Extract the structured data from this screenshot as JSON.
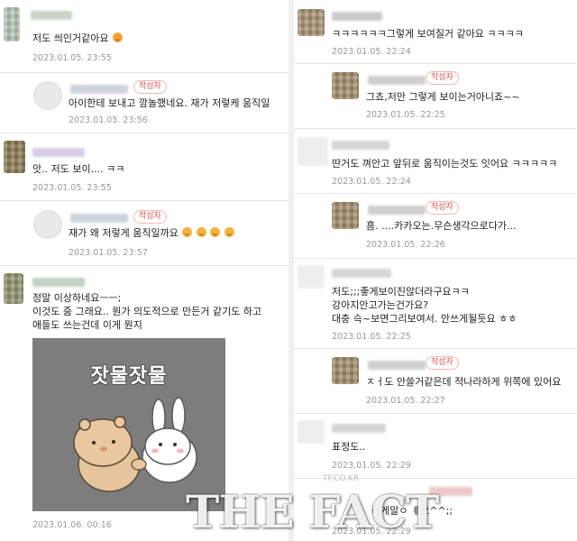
{
  "left": {
    "c1": {
      "text": "저도 씌인거같아요",
      "date": "2023.01.05. 23:55"
    },
    "r1": {
      "badge": "작성자",
      "text": "아이한테 보내고 깜놀했네요. 재가 저렇케 움직일",
      "date": "2023.01.05. 23:56"
    },
    "c2": {
      "text": "앗.. 저도 보이.... ㅋㅋ",
      "date": "2023.01.05. 23:55"
    },
    "r2": {
      "badge": "작성자",
      "text": "재가 왜 저렇게 움직일까요",
      "date": "2023.01.05. 23:57"
    },
    "c3": {
      "lines": [
        "정말 이상하네요ㅡㅡ;",
        "이것도 줌 그래요.. 뭔가 의도적으로 만든거 같기도 하고",
        "애들도 쓰는건데 이게 뭔지"
      ],
      "sticker_text": "잣물잣물",
      "date": "2023.01.06. 00:16"
    }
  },
  "right": {
    "c1": {
      "text": "ㅋㅋㅋㅋㅋㅋ그렇게 보여질거 같아요 ㅋㅋㅋㅋ",
      "date": "2023.01.05. 22:24"
    },
    "r1": {
      "badge": "작성자",
      "text": "그쵸,저만 그렇게 보이는거아니죠~~",
      "date": "2023.01.05. 22:25"
    },
    "c2": {
      "text": "딴거도 껴안고 앞뒤로 움직이는것도 잇어요 ㅋㅋㅋㅋㅋ",
      "date": "2023.01.05. 22:24"
    },
    "r2": {
      "badge": "작성자",
      "text": "흠. ....카카오는.무슨생각으로다가...",
      "date": "2023.01.05. 22:26"
    },
    "c3": {
      "lines": [
        "저도;;;좋게보이진않더라구요ㅋㅋ",
        "강아지안고가는건가요?",
        "대충 슥~보면그리보여서. 안쓰게될듯요 ㅎㅎ"
      ],
      "date": "2023.01.05. 22:25"
    },
    "r3": {
      "badge": "작성자",
      "text": "ㅈㅓ도 안쓸거같은데 적나라하게 위쪽에 있어요",
      "date": "2023.01.05. 22:27"
    },
    "c4": {
      "text": "표정도..",
      "date": "2023.01.05. 22:29"
    },
    "c5": {
      "text": "러게말ㅇ ㅖ요^^;;",
      "date": "2023.01.05. 22:29"
    }
  },
  "watermark": {
    "brand": "THE FACT",
    "small": "TF.CO.KR"
  }
}
